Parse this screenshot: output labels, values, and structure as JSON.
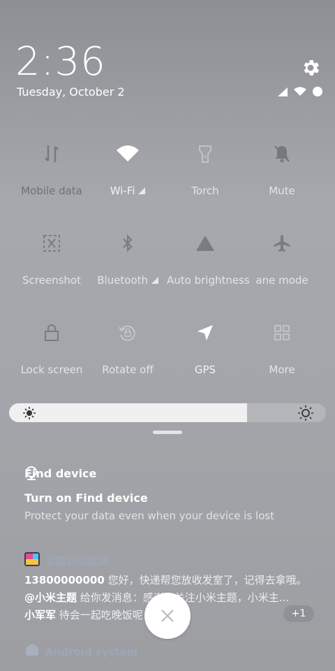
{
  "clock": {
    "time": "2:36",
    "date": "Tuesday, October 2"
  },
  "icons": {
    "settings": "gear-icon",
    "signal": "signal-icon",
    "wifi": "wifi-icon",
    "battery": "battery-icon"
  },
  "tiles": [
    {
      "label": "Mobile data",
      "icon": "mobile-data-icon",
      "state": "off"
    },
    {
      "label": "Wi-Fi",
      "icon": "wifi-icon",
      "state": "on"
    },
    {
      "label": "Torch",
      "icon": "torch-icon",
      "state": "off"
    },
    {
      "label": "Mute",
      "icon": "mute-icon",
      "state": "off"
    },
    {
      "label": "Screenshot",
      "icon": "screenshot-icon",
      "state": "off"
    },
    {
      "label": "Bluetooth",
      "icon": "bluetooth-icon",
      "state": "off"
    },
    {
      "label": "Auto brightness",
      "icon": "auto-brightness-icon",
      "state": "off"
    },
    {
      "label": "ane mode",
      "icon": "airplane-icon",
      "state": "off"
    },
    {
      "label": "Lock screen",
      "icon": "lock-icon",
      "state": "off"
    },
    {
      "label": "Rotate off",
      "icon": "rotate-icon",
      "state": "off"
    },
    {
      "label": "GPS",
      "icon": "gps-icon",
      "state": "on"
    },
    {
      "label": "More",
      "icon": "grid-icon",
      "state": "off"
    }
  ],
  "brightness": {
    "level": 0.75
  },
  "notifications": {
    "find_device": {
      "app": "Find device",
      "title": "Turn on Find device",
      "body": "Protect your data even when your device is lost"
    },
    "theme": {
      "app": "主题自动截屏",
      "lines": [
        {
          "sender": "13800000000",
          "message": "您好，快递帮您放收发室了，记得去拿哦。"
        },
        {
          "sender": "@小米主题",
          "message": "给你发消息：感谢您关注小米主题，小米主..."
        },
        {
          "sender": "小军军",
          "message": "待会一起吃晚饭呢"
        }
      ],
      "more_count": "+1"
    },
    "android": {
      "app": "Android system"
    }
  },
  "colors": {
    "tile_on": "#ffffff",
    "tile_off": "#6f7176",
    "slider_fill": "#f0f0f0",
    "slider_track": "#b4b6ba"
  }
}
